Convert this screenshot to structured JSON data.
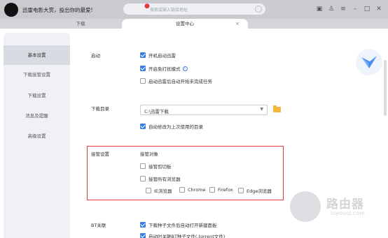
{
  "titlebar": {
    "promo": "迅雷电影大赏，投出你的最爱!",
    "search_placeholder": "搜索或输入链接地址"
  },
  "tabs": {
    "download": "下载",
    "settings": "设置中心"
  },
  "sidebar": {
    "items": [
      {
        "label": "基本设置"
      },
      {
        "label": "下载接管设置"
      },
      {
        "label": "下载设置"
      },
      {
        "label": "消息及提醒"
      },
      {
        "label": "高级设置"
      }
    ]
  },
  "startup": {
    "label": "启动",
    "options": [
      {
        "label": "开机启动迅雷",
        "checked": true
      },
      {
        "label": "开启免打扰模式",
        "checked": true
      },
      {
        "label": "启动迅雷后自动开始未完成任务",
        "checked": false
      }
    ]
  },
  "download_dir": {
    "label": "下载目录",
    "value": "C:\\迅雷下载",
    "remember_option": "自动修改为上次使用的目录"
  },
  "takeover": {
    "label": "接管设置",
    "object_label": "接管对象",
    "clipboard": "接管剪切板",
    "all_browsers": "接管所有浏览器",
    "browsers": [
      {
        "label": "IE浏览器"
      },
      {
        "label": "Chrome"
      },
      {
        "label": "Firefox"
      },
      {
        "label": "Edge浏览器"
      }
    ]
  },
  "bt": {
    "label": "BT关联",
    "options": [
      {
        "label": "下载种子文件后自动打开新建面板",
        "checked": true
      },
      {
        "label": "启动时关联BT种子文件(.torrent文件)",
        "checked": true
      }
    ]
  },
  "watermark": {
    "text": "路由器",
    "url": "luyouqi.com"
  },
  "colors": {
    "accent": "#3b7de0",
    "highlight_box": "#e03c3c"
  }
}
